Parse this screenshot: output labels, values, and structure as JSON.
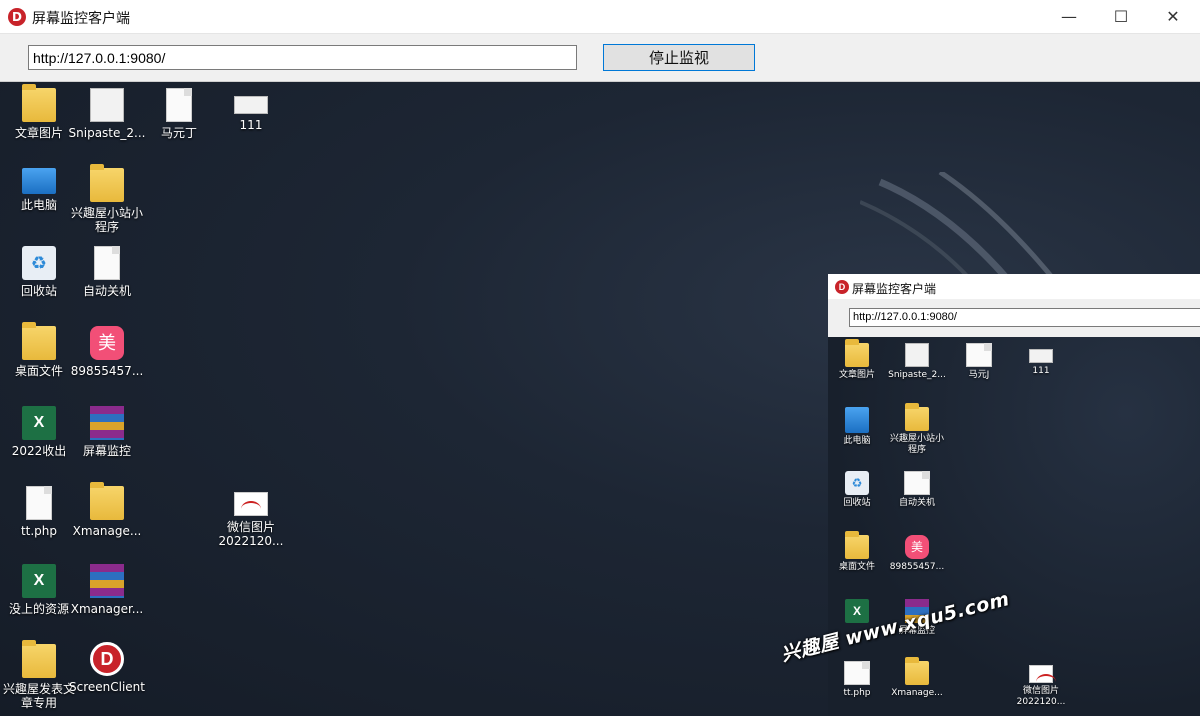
{
  "window": {
    "title": "屏幕监控客户端",
    "minimize_glyph": "—",
    "maximize_glyph": "☐",
    "close_glyph": "✕"
  },
  "toolbar": {
    "url_value": "http://127.0.0.1:9080/",
    "stop_button_label": "停止监视"
  },
  "desktop": {
    "icons": [
      {
        "label": "文章图片",
        "icon": "folder-icon"
      },
      {
        "label": "Snipaste_2...",
        "icon": "image-thumb-icon"
      },
      {
        "label": "马元丁",
        "icon": "document-thumb-icon"
      },
      {
        "label": "111",
        "icon": "image-thumb-icon"
      },
      {
        "label": "此电脑",
        "icon": "computer-icon"
      },
      {
        "label": "兴趣屋小站小程序",
        "icon": "folder-icon"
      },
      {
        "label": "回收站",
        "icon": "recycle-bin-icon"
      },
      {
        "label": "自动关机",
        "icon": "file-icon"
      },
      {
        "label": "桌面文件",
        "icon": "folder-icon"
      },
      {
        "label": "89855457...",
        "icon": "meitu-app-icon"
      },
      {
        "label": "2022收出",
        "icon": "excel-icon"
      },
      {
        "label": "屏幕监控",
        "icon": "rar-archive-icon"
      },
      {
        "label": "tt.php",
        "icon": "file-icon"
      },
      {
        "label": "Xmanage...",
        "icon": "folder-icon"
      },
      {
        "label": "微信图片 2022120...",
        "icon": "image-thumb-icon"
      },
      {
        "label": "没上的资源",
        "icon": "excel-icon"
      },
      {
        "label": "Xmanager...",
        "icon": "rar-archive-icon"
      },
      {
        "label": "兴趣屋发表文章专用",
        "icon": "folder-icon"
      },
      {
        "label": "ScreenClient",
        "icon": "screenclient-app-icon"
      }
    ]
  },
  "nested_window": {
    "title": "屏幕监控客户端",
    "url_value": "http://127.0.0.1:9080/",
    "icons": [
      {
        "label": "文章图片"
      },
      {
        "label": "Snipaste_2..."
      },
      {
        "label": "马元J"
      },
      {
        "label": "111"
      },
      {
        "label": "此电脑"
      },
      {
        "label": "兴趣屋小站小程序"
      },
      {
        "label": "回收站"
      },
      {
        "label": "自动关机"
      },
      {
        "label": "桌面文件"
      },
      {
        "label": "89855457..."
      },
      {
        "label": "屏幕监控"
      },
      {
        "label": "tt.php"
      },
      {
        "label": "Xmanage..."
      },
      {
        "label": "微信图片 2022120..."
      }
    ]
  },
  "watermark": "兴趣屋 www.xqu5.com",
  "colors": {
    "accent": "#0078d7",
    "brand_red": "#c8232a",
    "desktop_bg": "#1b2330"
  }
}
